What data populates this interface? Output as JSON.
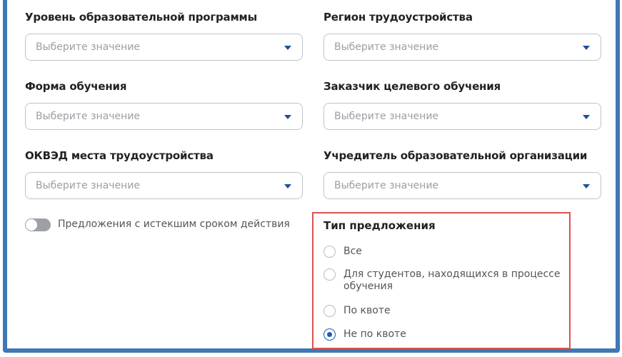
{
  "fields": [
    {
      "label": "Уровень образовательной программы",
      "placeholder": "Выберите значение"
    },
    {
      "label": "Регион трудоустройства",
      "placeholder": "Выберите значение"
    },
    {
      "label": "Форма обучения",
      "placeholder": "Выберите значение"
    },
    {
      "label": "Заказчик целевого обучения",
      "placeholder": "Выберите значение"
    },
    {
      "label": "ОКВЭД места трудоустройства",
      "placeholder": "Выберите значение"
    },
    {
      "label": "Учредитель образовательной организации",
      "placeholder": "Выберите значение"
    }
  ],
  "toggle": {
    "label": "Предложения с истекшим сроком действия",
    "on": false
  },
  "offer_type": {
    "title": "Тип предложения",
    "options": [
      "Все",
      "Для студентов, находящихся в процессе обучения",
      "По квоте",
      "Не по квоте"
    ],
    "selected": "Не по квоте"
  },
  "colors": {
    "frame": "#3f78b5",
    "highlight": "#d9534f",
    "accent": "#1c5cb8"
  }
}
